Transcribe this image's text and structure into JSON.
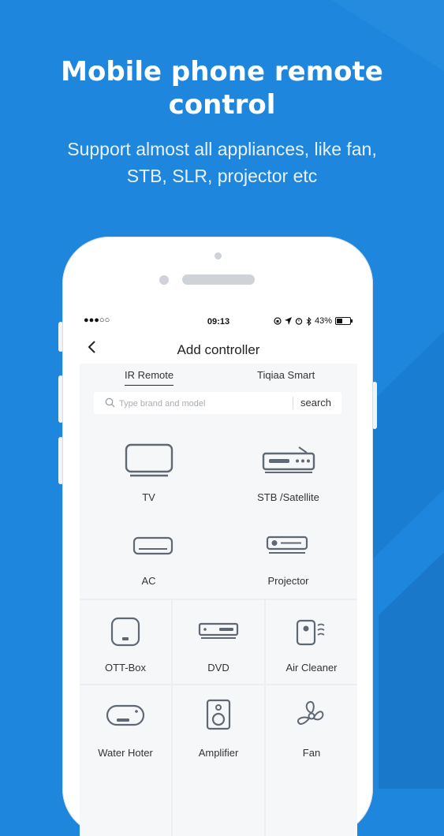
{
  "promo": {
    "title_line1": "Mobile phone remote",
    "title_line2": "control",
    "subtitle_line1": "Support almost all appliances, like fan,",
    "subtitle_line2": "STB, SLR, projector etc"
  },
  "status_bar": {
    "signal": "●●●○○",
    "time": "09:13",
    "battery_text": "43%",
    "battery_level": 0.43
  },
  "nav": {
    "back_symbol": "‹",
    "title": "Add controller"
  },
  "tabs": [
    {
      "label": "IR Remote",
      "active": true
    },
    {
      "label": "Tiqiaa Smart",
      "active": false
    }
  ],
  "search": {
    "placeholder": "Type brand and model",
    "button_label": "search"
  },
  "devices": [
    {
      "label": "TV",
      "icon": "tv-icon"
    },
    {
      "label": "STB /Satellite",
      "icon": "set-top-box-icon"
    },
    {
      "label": "AC",
      "icon": "air-conditioner-icon"
    },
    {
      "label": "Projector",
      "icon": "projector-icon"
    },
    {
      "label": "OTT-Box",
      "icon": "ott-box-icon"
    },
    {
      "label": "DVD",
      "icon": "dvd-player-icon"
    },
    {
      "label": "Air Cleaner",
      "icon": "air-cleaner-icon"
    },
    {
      "label": "Water Hoter",
      "icon": "water-heater-icon"
    },
    {
      "label": "Amplifier",
      "icon": "speaker-icon"
    },
    {
      "label": "Fan",
      "icon": "fan-icon"
    }
  ],
  "colors": {
    "background": "#1e86dc",
    "icon_stroke": "#5f6873"
  }
}
